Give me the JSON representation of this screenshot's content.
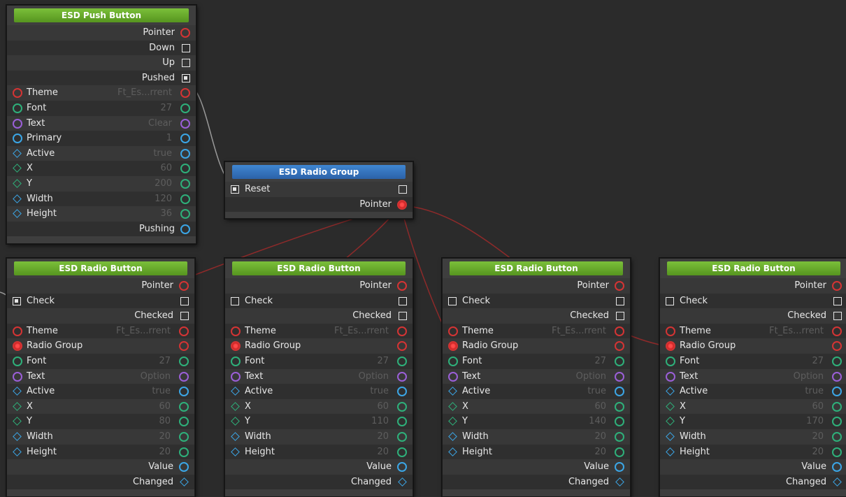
{
  "push_button": {
    "title": "ESD Push Button",
    "pointer": "Pointer",
    "down": "Down",
    "up": "Up",
    "pushed": "Pushed",
    "theme": {
      "label": "Theme",
      "value": "Ft_Es...rrent"
    },
    "font": {
      "label": "Font",
      "value": "27"
    },
    "text": {
      "label": "Text",
      "value": "Clear"
    },
    "primary": {
      "label": "Primary",
      "value": "1"
    },
    "active": {
      "label": "Active",
      "value": "true"
    },
    "x": {
      "label": "X",
      "value": "60"
    },
    "y": {
      "label": "Y",
      "value": "200"
    },
    "width": {
      "label": "Width",
      "value": "120"
    },
    "height": {
      "label": "Height",
      "value": "36"
    },
    "pushing": "Pushing"
  },
  "radio_group": {
    "title": "ESD Radio Group",
    "reset": "Reset",
    "pointer": "Pointer"
  },
  "radio_buttons": [
    {
      "title": "ESD Radio Button",
      "pointer": "Pointer",
      "check": "Check",
      "checked": "Checked",
      "theme": {
        "label": "Theme",
        "value": "Ft_Es...rrent"
      },
      "radio_group": "Radio Group",
      "font": {
        "label": "Font",
        "value": "27"
      },
      "text": {
        "label": "Text",
        "value": "Option"
      },
      "active": {
        "label": "Active",
        "value": "true"
      },
      "x": {
        "label": "X",
        "value": "60"
      },
      "y": {
        "label": "Y",
        "value": "80"
      },
      "width": {
        "label": "Width",
        "value": "20"
      },
      "height": {
        "label": "Height",
        "value": "20"
      },
      "value": "Value",
      "changed": "Changed"
    },
    {
      "title": "ESD Radio Button",
      "pointer": "Pointer",
      "check": "Check",
      "checked": "Checked",
      "theme": {
        "label": "Theme",
        "value": "Ft_Es...rrent"
      },
      "radio_group": "Radio Group",
      "font": {
        "label": "Font",
        "value": "27"
      },
      "text": {
        "label": "Text",
        "value": "Option"
      },
      "active": {
        "label": "Active",
        "value": "true"
      },
      "x": {
        "label": "X",
        "value": "60"
      },
      "y": {
        "label": "Y",
        "value": "110"
      },
      "width": {
        "label": "Width",
        "value": "20"
      },
      "height": {
        "label": "Height",
        "value": "20"
      },
      "value": "Value",
      "changed": "Changed"
    },
    {
      "title": "ESD Radio Button",
      "pointer": "Pointer",
      "check": "Check",
      "checked": "Checked",
      "theme": {
        "label": "Theme",
        "value": "Ft_Es...rrent"
      },
      "radio_group": "Radio Group",
      "font": {
        "label": "Font",
        "value": "27"
      },
      "text": {
        "label": "Text",
        "value": "Option"
      },
      "active": {
        "label": "Active",
        "value": "true"
      },
      "x": {
        "label": "X",
        "value": "60"
      },
      "y": {
        "label": "Y",
        "value": "140"
      },
      "width": {
        "label": "Width",
        "value": "20"
      },
      "height": {
        "label": "Height",
        "value": "20"
      },
      "value": "Value",
      "changed": "Changed"
    },
    {
      "title": "ESD Radio Button",
      "pointer": "Pointer",
      "check": "Check",
      "checked": "Checked",
      "theme": {
        "label": "Theme",
        "value": "Ft_Es...rrent"
      },
      "radio_group": "Radio Group",
      "font": {
        "label": "Font",
        "value": "27"
      },
      "text": {
        "label": "Text",
        "value": "Option"
      },
      "active": {
        "label": "Active",
        "value": "true"
      },
      "x": {
        "label": "X",
        "value": "60"
      },
      "y": {
        "label": "Y",
        "value": "170"
      },
      "width": {
        "label": "Width",
        "value": "20"
      },
      "height": {
        "label": "Height",
        "value": "20"
      },
      "value": "Value",
      "changed": "Changed"
    }
  ],
  "colors": {
    "canvas": "#2b2b2b",
    "node": "#3e3e3e",
    "header_green": "#6aab2c",
    "header_blue": "#3874be",
    "pointer_pin": "#d43434",
    "font_pin": "#2eb07a",
    "text_pin": "#9b5fd8",
    "bool_pin": "#3ba6e6",
    "wire_red": "#8e2a2a",
    "wire_gray": "#9a9a9a"
  }
}
